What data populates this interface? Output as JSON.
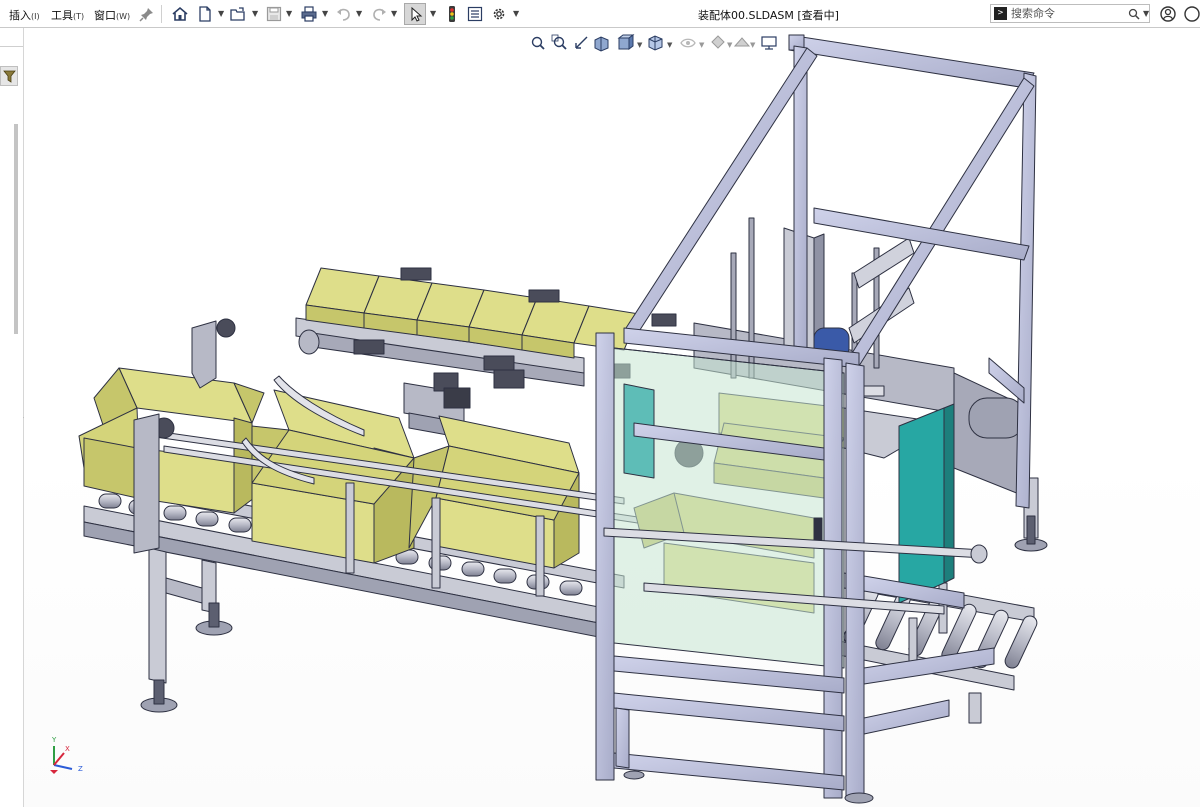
{
  "menu": {
    "items": [
      {
        "label": "插入",
        "accel": "(I)"
      },
      {
        "label": "工具",
        "accel": "(T)"
      },
      {
        "label": "窗口",
        "accel": "(W)"
      }
    ]
  },
  "window": {
    "title": "装配体00.SLDASM [查看中]"
  },
  "search": {
    "placeholder": "搜索命令"
  },
  "toolbar": {
    "icons": [
      "pin-icon",
      "home-icon",
      "new-doc-icon",
      "open-icon",
      "save-icon",
      "print-icon",
      "undo-icon",
      "redo-icon",
      "select-icon",
      "traffic-light-icon",
      "file-properties-icon",
      "options-gear-icon"
    ]
  },
  "triad": {
    "x": "X",
    "y": "Y",
    "z": "Z"
  },
  "colors": {
    "frame": "#b7bbd8",
    "frame_edge": "#2e3142",
    "box": "#dede8a",
    "glass": "#c7e6d2",
    "teal_panel": "#27a7a3",
    "steel": "#c9cbd5"
  }
}
